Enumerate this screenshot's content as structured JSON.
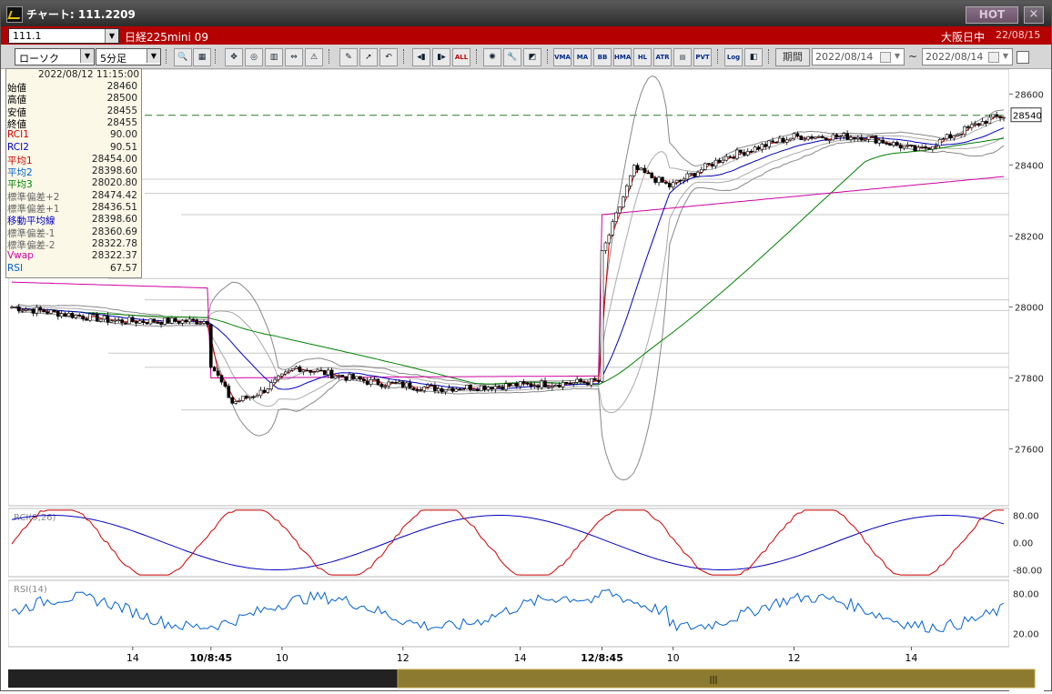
{
  "window": {
    "title": "チャート: 111.2209",
    "hot_label": "HOT",
    "close_glyph": "×"
  },
  "symbol_bar": {
    "code": "111.1",
    "name": "日経225mini 09",
    "market": "大阪日中",
    "date": "22/08/15"
  },
  "toolbar": {
    "chart_type": "ローソク",
    "interval": "5分足",
    "buttons": [
      "zoom-icon",
      "grid-icon",
      "crosshair-icon",
      "find-icon",
      "bar-chart-icon",
      "marker-icon",
      "warning-icon",
      "pencil-icon",
      "cursor-icon",
      "undo-icon",
      "candle-left-icon",
      "candle-right-icon",
      "ALL",
      "bomb-icon",
      "wrench-icon",
      "palette-icon",
      "VMA",
      "MA",
      "BB",
      "HMA",
      "HL",
      "ATR",
      "RVI",
      "PVT",
      "Log",
      "split-icon"
    ],
    "text_buttons": {
      "vma": "VMA",
      "ma": "MA",
      "bb": "BB",
      "hma": "HMA",
      "hl": "HL",
      "atr": "ATR",
      "pvt": "PVT",
      "log": "Log",
      "all": "ALL"
    },
    "period_label": "期間",
    "date_from": "2022/08/14",
    "date_to": "2022/08/14",
    "tilde": "~"
  },
  "data_window": {
    "timestamp": "2022/08/12  11:15:00",
    "rows": [
      {
        "label": "始値",
        "value": "28460",
        "color": "#000000"
      },
      {
        "label": "高値",
        "value": "28500",
        "color": "#000000"
      },
      {
        "label": "安値",
        "value": "28455",
        "color": "#000000"
      },
      {
        "label": "終値",
        "value": "28455",
        "color": "#000000"
      },
      {
        "label": "RCI1",
        "value": "90.00",
        "color": "#d00000"
      },
      {
        "label": "RCI2",
        "value": "90.51",
        "color": "#0000c0"
      },
      {
        "label": "平均1",
        "value": "28454.00",
        "color": "#d00000"
      },
      {
        "label": "平均2",
        "value": "28398.60",
        "color": "#0060d0"
      },
      {
        "label": "平均3",
        "value": "28020.80",
        "color": "#008000"
      },
      {
        "label": "標準偏差+2",
        "value": "28474.42",
        "color": "#666666"
      },
      {
        "label": "標準偏差+1",
        "value": "28436.51",
        "color": "#666666"
      },
      {
        "label": "移動平均線",
        "value": "28398.60",
        "color": "#0000c0"
      },
      {
        "label": "標準偏差-1",
        "value": "28360.69",
        "color": "#666666"
      },
      {
        "label": "標準偏差-2",
        "value": "28322.78",
        "color": "#666666"
      },
      {
        "label": "Vwap",
        "value": "28322.37",
        "color": "#d000a0"
      },
      {
        "label": "RSI",
        "value": "67.57",
        "color": "#0060d0"
      }
    ]
  },
  "chart_data": [
    {
      "type": "candlestick",
      "yticks": [
        27600,
        27800,
        28000,
        28200,
        28400,
        28600
      ],
      "ylim": [
        27440,
        28670
      ],
      "current_price": "28540",
      "current_price_level": 28540,
      "x_tick_labels": [
        "14",
        "10/8:45",
        "10",
        "12",
        "14",
        "12/8:45",
        "10",
        "12",
        "14"
      ],
      "key_points": [
        {
          "x": 0,
          "y": 28000
        },
        {
          "x": 30,
          "y": 27960
        },
        {
          "x": 55,
          "y": 27960
        },
        {
          "x": 56,
          "y": 27840
        },
        {
          "x": 62,
          "y": 27730
        },
        {
          "x": 70,
          "y": 27760
        },
        {
          "x": 80,
          "y": 27830
        },
        {
          "x": 100,
          "y": 27790
        },
        {
          "x": 120,
          "y": 27770
        },
        {
          "x": 165,
          "y": 27790
        },
        {
          "x": 166,
          "y": 28150
        },
        {
          "x": 175,
          "y": 28390
        },
        {
          "x": 185,
          "y": 28340
        },
        {
          "x": 200,
          "y": 28420
        },
        {
          "x": 220,
          "y": 28480
        },
        {
          "x": 240,
          "y": 28480
        },
        {
          "x": 255,
          "y": 28440
        },
        {
          "x": 275,
          "y": 28530
        }
      ],
      "series": [
        {
          "name": "平均1",
          "color": "#d00000"
        },
        {
          "name": "平均2",
          "color": "#0000c0"
        },
        {
          "name": "平均3",
          "color": "#008000"
        },
        {
          "name": "Vwap",
          "color": "#d000a0"
        }
      ]
    },
    {
      "type": "line",
      "title": "RCI(9,26)",
      "yticks": [
        80,
        0,
        -80
      ],
      "ytick_labels": [
        "80.00",
        "0.00",
        "-80.00"
      ],
      "ylim": [
        -100,
        100
      ],
      "series": [
        {
          "name": "RCI1",
          "color": "#d00000"
        },
        {
          "name": "RCI2",
          "color": "#0000c0"
        }
      ]
    },
    {
      "type": "line",
      "title": "RSI(14)",
      "yticks": [
        80,
        20
      ],
      "ytick_labels": [
        "80.00",
        "20.00"
      ],
      "ylim": [
        0,
        100
      ],
      "series": [
        {
          "name": "RSI",
          "color": "#0060d0"
        }
      ]
    }
  ]
}
